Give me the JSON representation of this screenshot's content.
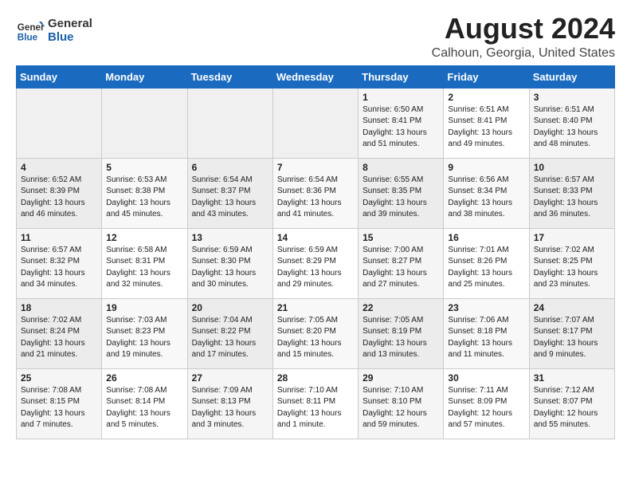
{
  "header": {
    "logo_text_general": "General",
    "logo_text_blue": "Blue",
    "month_year": "August 2024",
    "location": "Calhoun, Georgia, United States"
  },
  "days_of_week": [
    "Sunday",
    "Monday",
    "Tuesday",
    "Wednesday",
    "Thursday",
    "Friday",
    "Saturday"
  ],
  "weeks": [
    [
      {
        "day": "",
        "info": ""
      },
      {
        "day": "",
        "info": ""
      },
      {
        "day": "",
        "info": ""
      },
      {
        "day": "",
        "info": ""
      },
      {
        "day": "1",
        "info": "Sunrise: 6:50 AM\nSunset: 8:41 PM\nDaylight: 13 hours\nand 51 minutes."
      },
      {
        "day": "2",
        "info": "Sunrise: 6:51 AM\nSunset: 8:41 PM\nDaylight: 13 hours\nand 49 minutes."
      },
      {
        "day": "3",
        "info": "Sunrise: 6:51 AM\nSunset: 8:40 PM\nDaylight: 13 hours\nand 48 minutes."
      }
    ],
    [
      {
        "day": "4",
        "info": "Sunrise: 6:52 AM\nSunset: 8:39 PM\nDaylight: 13 hours\nand 46 minutes."
      },
      {
        "day": "5",
        "info": "Sunrise: 6:53 AM\nSunset: 8:38 PM\nDaylight: 13 hours\nand 45 minutes."
      },
      {
        "day": "6",
        "info": "Sunrise: 6:54 AM\nSunset: 8:37 PM\nDaylight: 13 hours\nand 43 minutes."
      },
      {
        "day": "7",
        "info": "Sunrise: 6:54 AM\nSunset: 8:36 PM\nDaylight: 13 hours\nand 41 minutes."
      },
      {
        "day": "8",
        "info": "Sunrise: 6:55 AM\nSunset: 8:35 PM\nDaylight: 13 hours\nand 39 minutes."
      },
      {
        "day": "9",
        "info": "Sunrise: 6:56 AM\nSunset: 8:34 PM\nDaylight: 13 hours\nand 38 minutes."
      },
      {
        "day": "10",
        "info": "Sunrise: 6:57 AM\nSunset: 8:33 PM\nDaylight: 13 hours\nand 36 minutes."
      }
    ],
    [
      {
        "day": "11",
        "info": "Sunrise: 6:57 AM\nSunset: 8:32 PM\nDaylight: 13 hours\nand 34 minutes."
      },
      {
        "day": "12",
        "info": "Sunrise: 6:58 AM\nSunset: 8:31 PM\nDaylight: 13 hours\nand 32 minutes."
      },
      {
        "day": "13",
        "info": "Sunrise: 6:59 AM\nSunset: 8:30 PM\nDaylight: 13 hours\nand 30 minutes."
      },
      {
        "day": "14",
        "info": "Sunrise: 6:59 AM\nSunset: 8:29 PM\nDaylight: 13 hours\nand 29 minutes."
      },
      {
        "day": "15",
        "info": "Sunrise: 7:00 AM\nSunset: 8:27 PM\nDaylight: 13 hours\nand 27 minutes."
      },
      {
        "day": "16",
        "info": "Sunrise: 7:01 AM\nSunset: 8:26 PM\nDaylight: 13 hours\nand 25 minutes."
      },
      {
        "day": "17",
        "info": "Sunrise: 7:02 AM\nSunset: 8:25 PM\nDaylight: 13 hours\nand 23 minutes."
      }
    ],
    [
      {
        "day": "18",
        "info": "Sunrise: 7:02 AM\nSunset: 8:24 PM\nDaylight: 13 hours\nand 21 minutes."
      },
      {
        "day": "19",
        "info": "Sunrise: 7:03 AM\nSunset: 8:23 PM\nDaylight: 13 hours\nand 19 minutes."
      },
      {
        "day": "20",
        "info": "Sunrise: 7:04 AM\nSunset: 8:22 PM\nDaylight: 13 hours\nand 17 minutes."
      },
      {
        "day": "21",
        "info": "Sunrise: 7:05 AM\nSunset: 8:20 PM\nDaylight: 13 hours\nand 15 minutes."
      },
      {
        "day": "22",
        "info": "Sunrise: 7:05 AM\nSunset: 8:19 PM\nDaylight: 13 hours\nand 13 minutes."
      },
      {
        "day": "23",
        "info": "Sunrise: 7:06 AM\nSunset: 8:18 PM\nDaylight: 13 hours\nand 11 minutes."
      },
      {
        "day": "24",
        "info": "Sunrise: 7:07 AM\nSunset: 8:17 PM\nDaylight: 13 hours\nand 9 minutes."
      }
    ],
    [
      {
        "day": "25",
        "info": "Sunrise: 7:08 AM\nSunset: 8:15 PM\nDaylight: 13 hours\nand 7 minutes."
      },
      {
        "day": "26",
        "info": "Sunrise: 7:08 AM\nSunset: 8:14 PM\nDaylight: 13 hours\nand 5 minutes."
      },
      {
        "day": "27",
        "info": "Sunrise: 7:09 AM\nSunset: 8:13 PM\nDaylight: 13 hours\nand 3 minutes."
      },
      {
        "day": "28",
        "info": "Sunrise: 7:10 AM\nSunset: 8:11 PM\nDaylight: 13 hours\nand 1 minute."
      },
      {
        "day": "29",
        "info": "Sunrise: 7:10 AM\nSunset: 8:10 PM\nDaylight: 12 hours\nand 59 minutes."
      },
      {
        "day": "30",
        "info": "Sunrise: 7:11 AM\nSunset: 8:09 PM\nDaylight: 12 hours\nand 57 minutes."
      },
      {
        "day": "31",
        "info": "Sunrise: 7:12 AM\nSunset: 8:07 PM\nDaylight: 12 hours\nand 55 minutes."
      }
    ]
  ]
}
